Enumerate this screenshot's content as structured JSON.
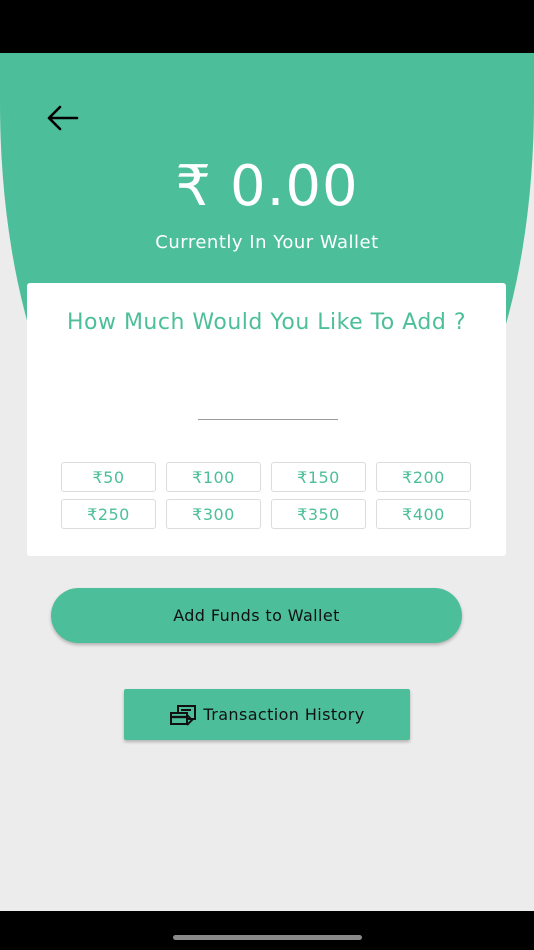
{
  "header": {
    "currency_symbol": "₹",
    "balance": "0.00",
    "caption": "Currently In Your Wallet"
  },
  "card": {
    "question": "How Much Would You Like To Add ?",
    "amount_input": {
      "value": "",
      "placeholder": ""
    },
    "quick_amounts": [
      "₹50",
      "₹100",
      "₹150",
      "₹200",
      "₹250",
      "₹300",
      "₹350",
      "₹400"
    ]
  },
  "actions": {
    "add_funds_label": "Add Funds to Wallet",
    "history_label": "Transaction History"
  },
  "icons": {
    "back": "arrow-left-icon",
    "history": "transaction-history-icon"
  },
  "colors": {
    "accent": "#4cbf9a",
    "background": "#ececec"
  }
}
